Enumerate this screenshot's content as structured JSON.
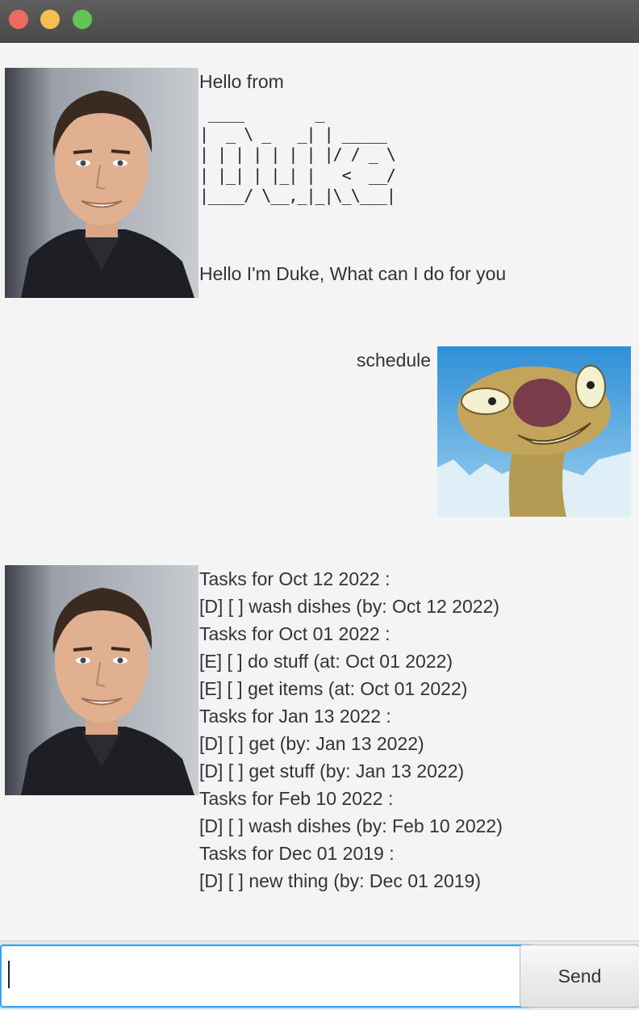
{
  "window": {
    "traffic_lights": [
      "close",
      "minimize",
      "zoom"
    ]
  },
  "messages": [
    {
      "sender": "duke",
      "avatar_icon": "duke-portrait-icon",
      "greeting": "Hello from",
      "ascii_logo": " ____        _        \n|  _ \\ _   _| | _____ \n| | | | | | | |/ / _ \\\n| |_| | |_| |   <  __/\n|____/ \\__,_|_|\\_\\___|",
      "intro": "Hello I'm Duke, What can I do for you"
    },
    {
      "sender": "user",
      "avatar_icon": "sloth-portrait-icon",
      "text": "schedule"
    },
    {
      "sender": "duke",
      "avatar_icon": "duke-portrait-icon",
      "lines": [
        "Tasks for Oct 12 2022 :",
        "[D] [ ] wash dishes (by: Oct 12 2022)",
        "Tasks for Oct 01 2022 :",
        "[E] [ ] do stuff (at: Oct 01 2022)",
        "[E] [ ] get items (at: Oct 01 2022)",
        "Tasks for Jan 13 2022 :",
        "[D] [ ] get (by: Jan 13 2022)",
        "[D] [ ] get stuff (by: Jan 13 2022)",
        "Tasks for Feb 10 2022 :",
        "[D] [ ] wash dishes (by: Feb 10 2022)",
        "Tasks for Dec 01 2019 :",
        "[D] [ ] new thing (by: Dec 01 2019)"
      ]
    }
  ],
  "input": {
    "value": "",
    "placeholder": ""
  },
  "send_button": {
    "label": "Send"
  },
  "colors": {
    "accent": "#3aa5e6",
    "background": "#f4f4f4",
    "titlebar": "#555555"
  }
}
